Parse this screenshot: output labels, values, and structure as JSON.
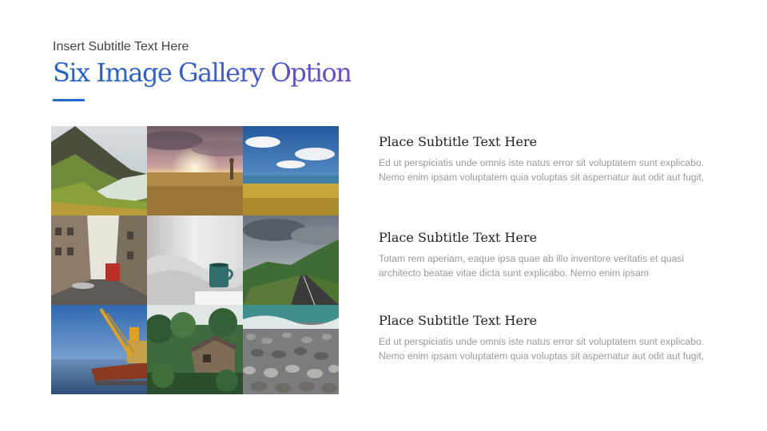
{
  "header": {
    "subtitle": "Insert Subtitle Text Here",
    "title": "Six Image Gallery Option",
    "title_gradient": [
      "#1f64c9",
      "#6b49cf"
    ],
    "accent_color": "#1f6fd1"
  },
  "gallery": {
    "images": [
      "mountain-coast-photo",
      "sunset-field-photo",
      "coastal-grass-photo",
      "city-street-photo",
      "coffee-cup-bed-photo",
      "mountain-road-photo",
      "harbor-crane-ship-photo",
      "jungle-house-photo",
      "pebble-beach-photo"
    ]
  },
  "items": [
    {
      "heading": "Place Subtitle Text Here",
      "body": "Ed ut perspiciatis unde omnis iste natus error sit voluptatem sunt explicabo. Nemo enim ipsam voluptatem quia voluptas sit aspernatur aut odit aut fugit,"
    },
    {
      "heading": "Place Subtitle Text Here",
      "body": "Totam rem aperiam, eaque ipsa quae ab illo inventore veritatis et quasi architecto beatae vitae dicta sunt explicabo. Nemo enim ipsam"
    },
    {
      "heading": "Place Subtitle Text Here",
      "body": "Ed ut perspiciatis unde omnis iste natus error sit voluptatem sunt explicabo. Nemo enim ipsam voluptatem quia voluptas sit aspernatur aut odit aut fugit,"
    }
  ]
}
